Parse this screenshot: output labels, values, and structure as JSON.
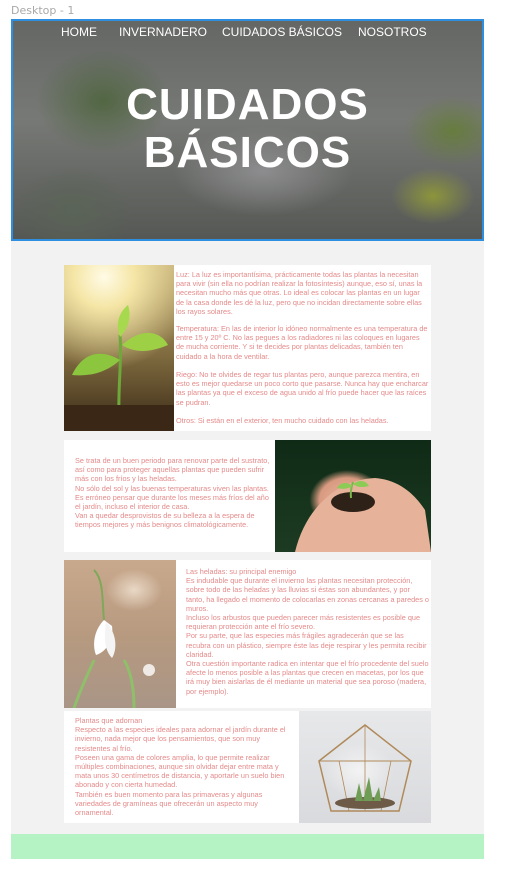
{
  "frame_label": "Desktop - 1",
  "nav": {
    "items": [
      "HOME",
      "INVERNADERO",
      "CUIDADOS BÁSICOS",
      "NOSOTROS"
    ]
  },
  "hero": {
    "title_line1": "CUIDADOS",
    "title_line2": "BÁSICOS"
  },
  "sections": [
    {
      "image": "sprout-in-soil-photo",
      "paragraphs": [
        "Luz: La luz es importantísima, prácticamente todas las plantas la necesitan para vivir (sin ella no podrían realizar la fotosíntesis) aunque, eso sí, unas la necesitan mucho más que otras. Lo ideal es colocar las plantas en un lugar de la casa donde les dé la luz, pero que no incidan directamente sobre ellas los rayos solares.",
        "Temperatura: En las de interior lo idóneo normalmente es una temperatura de entre 15 y 20º C.  No las pegues a los radiadores ni las coloques en lugares de mucha corriente. Y si te decides por plantas delicadas, también ten cuidado a la hora de ventilar.",
        "Riego: No te olvides de regar tus plantas pero, aunque parezca mentira, en esto es mejor quedarse un poco corto que pasarse. Nunca hay que encharcar las plantas ya que el exceso de agua unido al frío puede hacer que las raíces se pudran.",
        "Otros: Si están en el exterior, ten mucho cuidado con las heladas."
      ]
    },
    {
      "image": "seedling-in-hand-photo",
      "paragraphs": [
        "Se trata de un buen periodo para renovar parte del sustrato, así como para proteger aquellas plantas que pueden sufrir más con los fríos y las heladas.\nNo sólo del sol y las buenas temperaturas viven las plantas. Es erróneo pensar que durante los meses más fríos del año el jardín, incluso el interior de casa.\nVan a quedar desprovistos de su belleza a la espera de tiempos mejores y más benignos climatológicamente."
      ]
    },
    {
      "image": "snowdrop-flower-photo",
      "paragraphs": [
        "Las heladas: su principal enemigo\nEs indudable que durante el invierno las plantas necesitan protección, sobre todo de las heladas y las lluvias si éstas son abundantes, y por tanto, ha llegado el momento de colocarlas en zonas cercanas a paredes o muros.\nIncluso los arbustos que pueden parecer más resistentes es posible que requieran protección ante el frío severo.\nPor su parte, que las especies más frágiles agradecerán que se las recubra con un plástico, siempre éste las deje respirar y les permita recibir claridad.\nOtra cuestión importante radica en intentar que el frío procedente del suelo afecte lo menos posible a las plantas que crecen en macetas, por los que irá muy bien aislarlas de él mediante un material que sea poroso (madera, por ejemplo)."
      ]
    },
    {
      "image": "glass-terrarium-photo",
      "paragraphs": [
        "Plantas que adornan\nRespecto a las especies ideales para adornar el jardín durante el invierno, nada mejor que los pensamientos, que son muy resistentes al frío.\nPoseen una gama de colores amplia, lo que permite realizar múltiples combinaciones, aunque sin olvidar dejar entre mata y mata unos 30 centímetros de distancia, y aportarle un suelo bien abonado y con cierta humedad.\nTambién es buen momento para las primaveras y algunas variedades de gramíneas que ofrecerán un aspecto muy ornamental."
      ]
    }
  ],
  "colors": {
    "text_accent": "#e48a8a",
    "frame_border": "#2e8fe0",
    "footer": "#b5f2c4",
    "background": "#f2f2f2"
  }
}
